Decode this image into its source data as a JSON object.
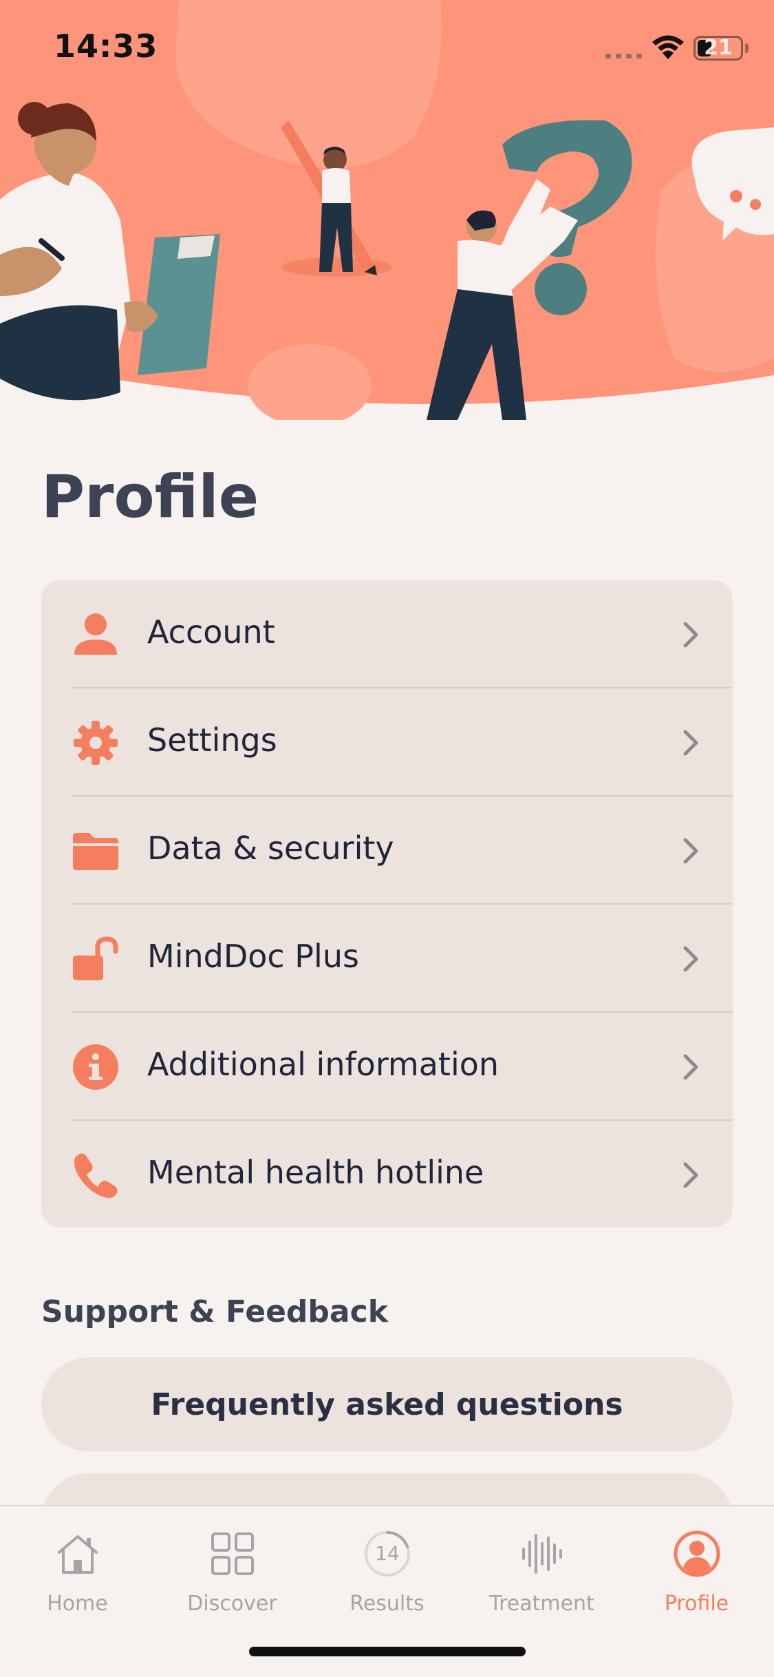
{
  "status_bar": {
    "time": "14:33",
    "battery_level": "21"
  },
  "page": {
    "title": "Profile"
  },
  "menu": {
    "items": [
      {
        "label": "Account",
        "icon": "person-icon"
      },
      {
        "label": "Settings",
        "icon": "gear-icon"
      },
      {
        "label": "Data & security",
        "icon": "folder-icon"
      },
      {
        "label": "MindDoc Plus",
        "icon": "unlocked-padlock-icon"
      },
      {
        "label": "Additional information",
        "icon": "info-icon"
      },
      {
        "label": "Mental health hotline",
        "icon": "phone-icon"
      }
    ]
  },
  "support": {
    "title": "Support & Feedback",
    "faq_label": "Frequently asked questions",
    "second_label": ""
  },
  "tab_bar": {
    "tabs": [
      {
        "label": "Home",
        "icon": "home-icon"
      },
      {
        "label": "Discover",
        "icon": "grid-icon"
      },
      {
        "label": "Results",
        "icon": "results-ring-icon",
        "count": "14"
      },
      {
        "label": "Treatment",
        "icon": "soundwave-icon"
      },
      {
        "label": "Profile",
        "icon": "profile-icon"
      }
    ],
    "active": "Profile"
  },
  "colors": {
    "accent": "#f47e5e",
    "hero_background": "#fe957a",
    "card_background": "#ece3de",
    "page_background": "#f7f2ef",
    "title_text": "#3d4254",
    "inactive_tab": "#a8a3a4"
  }
}
